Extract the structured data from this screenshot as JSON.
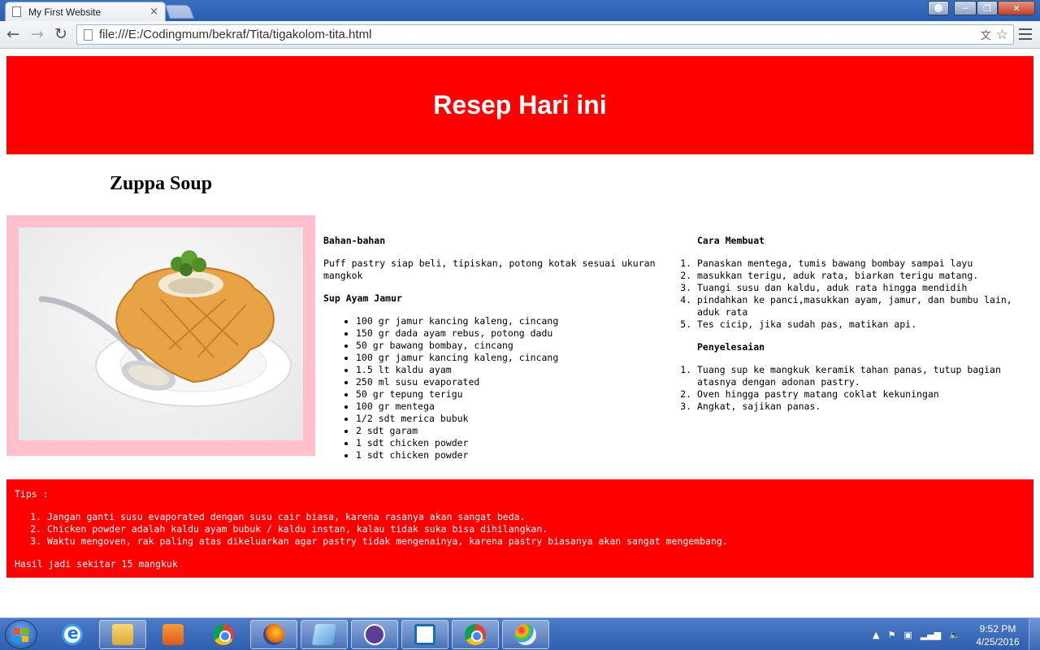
{
  "browser": {
    "tab_title": "My First Website",
    "tab_close": "×",
    "url": "file:///E:/Codingmum/bekraf/Tita/tigakolom-tita.html"
  },
  "page": {
    "header": "Resep Hari ini",
    "recipe_title": "Zuppa Soup",
    "ingredients": {
      "heading": "Bahan-bahan",
      "pastry_note": "Puff pastry siap beli, tipiskan, potong kotak sesuai ukuran mangkok",
      "subheading": "Sup Ayam Jamur",
      "items": [
        "100 gr jamur kancing kaleng, cincang",
        "150 gr dada ayam rebus, potong dadu",
        "50 gr bawang bombay, cincang",
        "100 gr jamur kancing kaleng, cincang",
        "1.5 lt kaldu ayam",
        "250 ml susu evaporated",
        "50 gr tepung terigu",
        "100 gr mentega",
        "1/2 sdt merica bubuk",
        "2 sdt garam",
        "1 sdt chicken powder",
        "1 sdt chicken powder"
      ]
    },
    "method": {
      "heading": "Cara Membuat",
      "steps": [
        "Panaskan mentega, tumis bawang bombay sampai layu",
        "masukkan terigu, aduk rata, biarkan terigu matang.",
        "Tuangi susu dan kaldu, aduk rata hingga mendidih",
        "pindahkan ke panci,masukkan ayam, jamur, dan bumbu lain, aduk rata",
        "Tes cicip, jika sudah pas, matikan api."
      ],
      "finish_heading": "Penyelesaian",
      "finish_steps": [
        "Tuang sup ke mangkuk keramik tahan panas, tutup bagian atasnya dengan adonan pastry.",
        "Oven hingga pastry matang coklat kekuningan",
        "Angkat, sajikan panas."
      ]
    },
    "tips": {
      "heading": "Tips :",
      "items": [
        "Jangan ganti susu evaporated dengan susu cair biasa, karena rasanya akan sangat beda.",
        "Chicken powder adalah kaldu ayam bubuk / kaldu instan, kalau tidak suka bisa dihilangkan.",
        "Waktu mengoven, rak paling atas dikeluarkan agar pastry tidak mengenainya, karena pastry biasanya akan sangat mengembang."
      ],
      "yield": "Hasil jadi sekitar 15 mangkuk"
    }
  },
  "taskbar": {
    "time": "9:52 PM",
    "date": "4/25/2016"
  },
  "colors": {
    "header_bg": "#ff0000",
    "photo_frame": "#ffc0cb",
    "tips_bg": "#ff0000"
  }
}
